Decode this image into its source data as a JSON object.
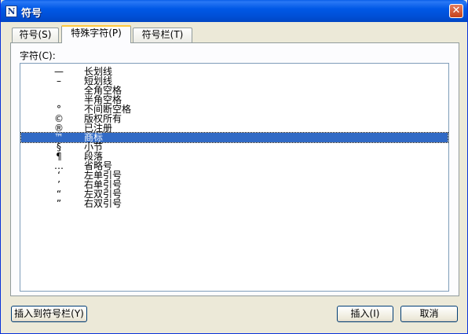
{
  "window": {
    "title": "符号",
    "app_icon": "N",
    "close_glyph": "✕"
  },
  "tabs": [
    {
      "label": "符号(S)",
      "active": false
    },
    {
      "label": "特殊字符(P)",
      "active": true
    },
    {
      "label": "符号栏(T)",
      "active": false
    }
  ],
  "panel": {
    "char_label": "字符(C):"
  },
  "characters": [
    {
      "symbol": "—",
      "name": "长划线"
    },
    {
      "symbol": "–",
      "name": "短划线"
    },
    {
      "symbol": "",
      "name": "全角空格"
    },
    {
      "symbol": "",
      "name": "半角空格"
    },
    {
      "symbol": "°",
      "name": "不间断空格"
    },
    {
      "symbol": "©",
      "name": "版权所有"
    },
    {
      "symbol": "®",
      "name": "已注册"
    },
    {
      "symbol": "™",
      "name": "商标",
      "selected": true
    },
    {
      "symbol": "§",
      "name": "小节"
    },
    {
      "symbol": "¶",
      "name": "段落"
    },
    {
      "symbol": "…",
      "name": "省略号"
    },
    {
      "symbol": "‘",
      "name": "左单引号"
    },
    {
      "symbol": "’",
      "name": "右单引号"
    },
    {
      "symbol": "“",
      "name": "左双引号"
    },
    {
      "symbol": "”",
      "name": "右双引号"
    }
  ],
  "buttons": {
    "insert_to_bar": "插入到符号栏(Y)",
    "insert": "插入(I)",
    "cancel": "取消"
  },
  "colors": {
    "selection": "#316ac5",
    "titlebar": "#0058e6"
  }
}
